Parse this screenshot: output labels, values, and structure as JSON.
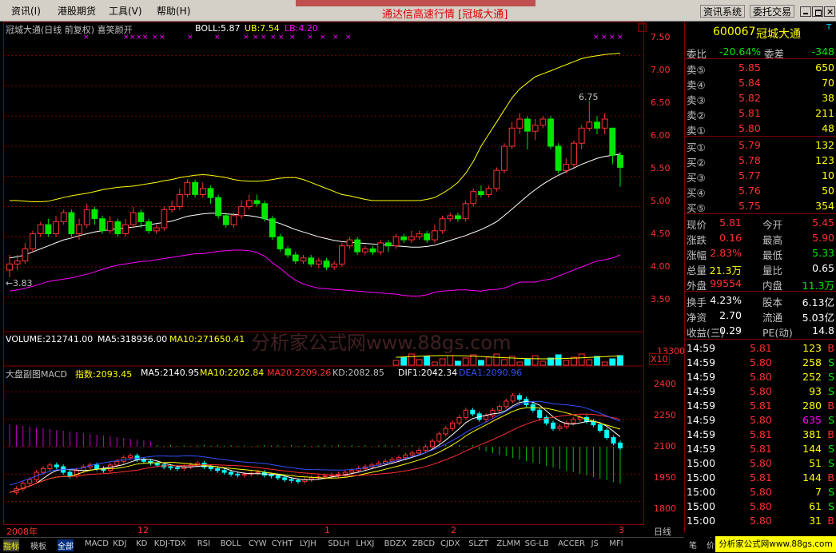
{
  "menu": {
    "items": [
      "资讯(I)",
      "港股期货",
      "工具(V)",
      "帮助(H)"
    ],
    "window_title": "通达信高速行情 [冠城大通]",
    "buttons": [
      "资讯系统",
      "委托交易"
    ]
  },
  "main_chart": {
    "title": "冠城大通(日线 前复权) 喜笑颜开",
    "boll_label": "BOLL:5.87",
    "ub_label": "UB:7.54",
    "lb_label": "LB:4.20",
    "price_ticks": [
      "7.50",
      "7.00",
      "6.50",
      "6.00",
      "5.50",
      "5.00",
      "4.50",
      "4.00",
      "3.50"
    ],
    "high_mark": "6.75",
    "low_mark": "3.83"
  },
  "volume_panel": {
    "label": "VOLUME:212741.00",
    "ma5": "MA5:318936.00",
    "ma10": "MA10:271650.41",
    "tick": "13300",
    "scale": "X10"
  },
  "watermark": "分析家公式网www.88gs.com",
  "index_panel": {
    "title": "大盘副图MACD",
    "index_val": "指数:2093.45",
    "ma5": "MA5:2140.95",
    "ma10": "MA10:2202.84",
    "ma20": "MA20:2209.26",
    "kd": "KD:2082.85",
    "dif1": "DIF1:2042.34",
    "dea1": "DEA1:2090.96",
    "ticks": [
      "2400",
      "2250",
      "2100",
      "1950",
      "1800"
    ]
  },
  "date_axis": {
    "labels": [
      "2008年",
      "12",
      "1",
      "2",
      "3"
    ],
    "period": "日线"
  },
  "quote": {
    "code": "600067",
    "name": "冠城大通",
    "wei_bi_label": "委比",
    "wei_bi": "-20.64%",
    "wei_cha_label": "委差",
    "wei_cha": "-348",
    "sell": [
      {
        "label": "卖⑤",
        "price": "5.85",
        "vol": "650"
      },
      {
        "label": "卖④",
        "price": "5.84",
        "vol": "70"
      },
      {
        "label": "卖③",
        "price": "5.82",
        "vol": "38"
      },
      {
        "label": "卖②",
        "price": "5.81",
        "vol": "211"
      },
      {
        "label": "卖①",
        "price": "5.80",
        "vol": "48"
      }
    ],
    "buy": [
      {
        "label": "买①",
        "price": "5.79",
        "vol": "132"
      },
      {
        "label": "买②",
        "price": "5.78",
        "vol": "123"
      },
      {
        "label": "买③",
        "price": "5.77",
        "vol": "10"
      },
      {
        "label": "买④",
        "price": "5.76",
        "vol": "50"
      },
      {
        "label": "买⑤",
        "price": "5.75",
        "vol": "354"
      }
    ],
    "stats": [
      {
        "l1": "现价",
        "v1": "5.81",
        "l2": "今开",
        "v2": "5.45"
      },
      {
        "l1": "涨跌",
        "v1": "0.16",
        "l2": "最高",
        "v2": "5.90"
      },
      {
        "l1": "涨幅",
        "v1": "2.83%",
        "l2": "最低",
        "v2": "5.33"
      },
      {
        "l1": "总量",
        "v1": "21.3万",
        "l2": "量比",
        "v2": "0.65"
      },
      {
        "l1": "外盘",
        "v1": "99554",
        "l2": "内盘",
        "v2": "11.3万"
      }
    ],
    "stats2": [
      {
        "l1": "换手",
        "v1": "4.23%",
        "l2": "股本",
        "v2": "6.13亿"
      },
      {
        "l1": "净资",
        "v1": "2.70",
        "l2": "流通",
        "v2": "5.03亿"
      },
      {
        "l1": "收益(三)",
        "v1": "0.29",
        "l2": "PE(动)",
        "v2": "14.8"
      }
    ],
    "ticks": [
      {
        "time": "14:59",
        "price": "5.81",
        "vol": "123",
        "bs": "B"
      },
      {
        "time": "14:59",
        "price": "5.80",
        "vol": "258",
        "bs": "S"
      },
      {
        "time": "14:59",
        "price": "5.80",
        "vol": "252",
        "bs": "S"
      },
      {
        "time": "14:59",
        "price": "5.80",
        "vol": "93",
        "bs": "S"
      },
      {
        "time": "14:59",
        "price": "5.81",
        "vol": "280",
        "bs": "B"
      },
      {
        "time": "14:59",
        "price": "5.80",
        "vol": "635",
        "bs": "S"
      },
      {
        "time": "14:59",
        "price": "5.81",
        "vol": "381",
        "bs": "B"
      },
      {
        "time": "14:59",
        "price": "5.81",
        "vol": "144",
        "bs": "S"
      },
      {
        "time": "15:00",
        "price": "5.80",
        "vol": "51",
        "bs": "S"
      },
      {
        "time": "15:00",
        "price": "5.81",
        "vol": "144",
        "bs": "B"
      },
      {
        "time": "15:00",
        "price": "5.80",
        "vol": "7",
        "bs": "S"
      },
      {
        "time": "15:00",
        "price": "5.80",
        "vol": "61",
        "bs": "S"
      },
      {
        "time": "15:00",
        "price": "5.80",
        "vol": "31",
        "bs": "B"
      }
    ]
  },
  "tabs": {
    "items": [
      "指标",
      "模板",
      "全部",
      "MACD",
      "KDJ",
      "KD",
      "KDJ-TDX",
      "RSI",
      "BOLL",
      "CYW",
      "CYHT",
      "LYJH",
      "SDLH",
      "LHXJ",
      "BDZX",
      "ZBCD",
      "CJDX",
      "SLZT",
      "ZLMM",
      "SG-LB",
      "ACCER",
      "JS",
      "MFI"
    ],
    "right": [
      "笔",
      "价"
    ],
    "logo": "分析家公式网www.88gs.com"
  },
  "colors": {
    "up": "#ff3232",
    "down": "#00e600",
    "bg": "#000000",
    "grid": "#800000",
    "boll": "#ffffff",
    "ub": "#ffff00",
    "lb": "#ff00ff"
  },
  "chart_data": {
    "type": "candlestick",
    "price_ylim": [
      3.3,
      7.8
    ],
    "index_ylim": [
      1750,
      2450
    ],
    "candles": [
      [
        3.95,
        4.05,
        4.2,
        3.83
      ],
      [
        4.05,
        4.1,
        4.2,
        3.95
      ],
      [
        4.1,
        4.3,
        4.4,
        4.05
      ],
      [
        4.3,
        4.55,
        4.6,
        4.25
      ],
      [
        4.55,
        4.7,
        4.75,
        4.5
      ],
      [
        4.7,
        4.55,
        4.8,
        4.5
      ],
      [
        4.55,
        4.75,
        4.85,
        4.5
      ],
      [
        4.75,
        4.9,
        4.95,
        4.7
      ],
      [
        4.9,
        4.55,
        4.95,
        4.5
      ],
      [
        4.55,
        4.7,
        4.8,
        4.45
      ],
      [
        4.7,
        4.95,
        5.05,
        4.65
      ],
      [
        4.95,
        4.8,
        5.0,
        4.7
      ],
      [
        4.8,
        4.6,
        4.85,
        4.55
      ],
      [
        4.6,
        4.75,
        4.85,
        4.55
      ],
      [
        4.75,
        4.55,
        4.8,
        4.5
      ],
      [
        4.55,
        4.7,
        4.8,
        4.5
      ],
      [
        4.7,
        4.9,
        5.0,
        4.65
      ],
      [
        4.9,
        4.75,
        4.95,
        4.65
      ],
      [
        4.75,
        4.6,
        4.8,
        4.55
      ],
      [
        4.6,
        4.65,
        4.7,
        4.55
      ],
      [
        4.65,
        4.95,
        5.0,
        4.6
      ],
      [
        4.95,
        5.0,
        5.1,
        4.9
      ],
      [
        5.0,
        5.2,
        5.3,
        4.95
      ],
      [
        5.2,
        5.4,
        5.45,
        5.15
      ],
      [
        5.4,
        5.2,
        5.45,
        5.15
      ],
      [
        5.2,
        5.3,
        5.4,
        5.15
      ],
      [
        5.3,
        5.15,
        5.35,
        5.05
      ],
      [
        5.15,
        4.85,
        5.2,
        4.8
      ],
      [
        4.85,
        4.7,
        4.9,
        4.65
      ],
      [
        4.7,
        4.85,
        4.9,
        4.65
      ],
      [
        4.85,
        5.0,
        5.1,
        4.8
      ],
      [
        5.0,
        5.1,
        5.2,
        4.95
      ],
      [
        5.1,
        5.05,
        5.2,
        5.0
      ],
      [
        5.05,
        4.8,
        5.1,
        4.75
      ],
      [
        4.8,
        4.5,
        4.85,
        4.45
      ],
      [
        4.5,
        4.3,
        4.55,
        4.25
      ],
      [
        4.3,
        4.2,
        4.35,
        4.15
      ],
      [
        4.2,
        4.1,
        4.25,
        4.05
      ],
      [
        4.1,
        4.15,
        4.2,
        4.05
      ],
      [
        4.15,
        4.05,
        4.2,
        4.0
      ],
      [
        4.05,
        4.1,
        4.15,
        3.98
      ],
      [
        4.1,
        4.0,
        4.15,
        3.95
      ],
      [
        4.0,
        4.05,
        4.1,
        3.95
      ],
      [
        4.05,
        4.35,
        4.4,
        4.0
      ],
      [
        4.35,
        4.45,
        4.5,
        4.3
      ],
      [
        4.45,
        4.25,
        4.5,
        4.2
      ],
      [
        4.25,
        4.3,
        4.35,
        4.2
      ],
      [
        4.3,
        4.25,
        4.35,
        4.2
      ],
      [
        4.25,
        4.4,
        4.45,
        4.2
      ],
      [
        4.4,
        4.35,
        4.45,
        4.25
      ],
      [
        4.35,
        4.5,
        4.55,
        4.3
      ],
      [
        4.5,
        4.45,
        4.55,
        4.4
      ],
      [
        4.45,
        4.5,
        4.6,
        4.4
      ],
      [
        4.5,
        4.55,
        4.6,
        4.45
      ],
      [
        4.55,
        4.45,
        4.6,
        4.4
      ],
      [
        4.45,
        4.6,
        4.7,
        4.4
      ],
      [
        4.6,
        4.8,
        4.85,
        4.55
      ],
      [
        4.8,
        4.85,
        4.9,
        4.75
      ],
      [
        4.85,
        4.8,
        4.9,
        4.75
      ],
      [
        4.8,
        5.05,
        5.1,
        4.75
      ],
      [
        5.05,
        5.25,
        5.3,
        5.0
      ],
      [
        5.25,
        5.2,
        5.35,
        5.15
      ],
      [
        5.2,
        5.3,
        5.35,
        5.15
      ],
      [
        5.3,
        5.6,
        5.65,
        5.25
      ],
      [
        5.6,
        6.0,
        6.05,
        5.55
      ],
      [
        6.0,
        6.3,
        6.4,
        5.95
      ],
      [
        6.3,
        6.45,
        6.55,
        6.2
      ],
      [
        6.45,
        6.25,
        6.5,
        5.95
      ],
      [
        6.25,
        6.35,
        6.45,
        6.1
      ],
      [
        6.35,
        6.45,
        6.5,
        6.3
      ],
      [
        6.45,
        6.0,
        6.5,
        5.95
      ],
      [
        6.0,
        5.6,
        6.05,
        5.55
      ],
      [
        5.6,
        5.7,
        5.8,
        5.55
      ],
      [
        5.7,
        6.05,
        6.1,
        5.65
      ],
      [
        6.05,
        6.3,
        6.35,
        5.95
      ],
      [
        6.3,
        6.4,
        6.75,
        6.25
      ],
      [
        6.4,
        6.3,
        6.5,
        6.2
      ],
      [
        6.3,
        6.45,
        6.55,
        6.2
      ],
      [
        6.3,
        5.85,
        6.3,
        5.7
      ],
      [
        5.85,
        5.65,
        5.9,
        5.33
      ]
    ],
    "boll": [
      4.15,
      4.17,
      4.2,
      4.25,
      4.3,
      4.35,
      4.4,
      4.45,
      4.48,
      4.52,
      4.55,
      4.58,
      4.6,
      4.62,
      4.63,
      4.65,
      4.66,
      4.68,
      4.7,
      4.72,
      4.74,
      4.76,
      4.8,
      4.84,
      4.86,
      4.88,
      4.89,
      4.89,
      4.88,
      4.87,
      4.86,
      4.85,
      4.83,
      4.8,
      4.76,
      4.72,
      4.67,
      4.62,
      4.58,
      4.54,
      4.5,
      4.47,
      4.44,
      4.42,
      4.41,
      4.4,
      4.39,
      4.38,
      4.37,
      4.36,
      4.35,
      4.34,
      4.33,
      4.33,
      4.34,
      4.36,
      4.4,
      4.44,
      4.48,
      4.52,
      4.57,
      4.62,
      4.68,
      4.75,
      4.85,
      4.96,
      5.07,
      5.18,
      5.28,
      5.37,
      5.45,
      5.52,
      5.58,
      5.64,
      5.7,
      5.75,
      5.8,
      5.83,
      5.85,
      5.87
    ],
    "ub": [
      5.1,
      5.1,
      5.09,
      5.08,
      5.08,
      5.09,
      5.12,
      5.15,
      5.18,
      5.2,
      5.22,
      5.25,
      5.28,
      5.3,
      5.32,
      5.33,
      5.34,
      5.36,
      5.38,
      5.4,
      5.43,
      5.45,
      5.48,
      5.5,
      5.52,
      5.53,
      5.52,
      5.5,
      5.48,
      5.45,
      5.43,
      5.42,
      5.42,
      5.43,
      5.45,
      5.47,
      5.48,
      5.48,
      5.45,
      5.4,
      5.35,
      5.3,
      5.25,
      5.2,
      5.18,
      5.15,
      5.12,
      5.1,
      5.1,
      5.1,
      5.1,
      5.1,
      5.1,
      5.1,
      5.12,
      5.15,
      5.22,
      5.3,
      5.4,
      5.55,
      5.75,
      6.0,
      6.2,
      6.4,
      6.6,
      6.8,
      6.95,
      7.05,
      7.15,
      7.2,
      7.25,
      7.3,
      7.35,
      7.4,
      7.45,
      7.48,
      7.5,
      7.52,
      7.53,
      7.54
    ],
    "lb": [
      3.6,
      3.62,
      3.65,
      3.68,
      3.72,
      3.76,
      3.78,
      3.8,
      3.82,
      3.85,
      3.88,
      3.92,
      3.96,
      4.0,
      4.03,
      4.05,
      4.07,
      4.09,
      4.1,
      4.12,
      4.14,
      4.16,
      4.18,
      4.2,
      4.22,
      4.22,
      4.24,
      4.26,
      4.27,
      4.28,
      4.28,
      4.27,
      4.24,
      4.18,
      4.07,
      3.98,
      3.87,
      3.78,
      3.72,
      3.68,
      3.65,
      3.64,
      3.63,
      3.62,
      3.61,
      3.6,
      3.59,
      3.58,
      3.57,
      3.56,
      3.55,
      3.53,
      3.52,
      3.52,
      3.54,
      3.58,
      3.6,
      3.61,
      3.62,
      3.62,
      3.61,
      3.6,
      3.62,
      3.63,
      3.65,
      3.7,
      3.75,
      3.75,
      3.75,
      3.78,
      3.8,
      3.85,
      3.9,
      3.95,
      4.0,
      4.05,
      4.1,
      4.12,
      4.15,
      4.2
    ],
    "index": [
      1850,
      1870,
      1900,
      1920,
      1960,
      1980,
      2000,
      1990,
      1960,
      1940,
      1970,
      1990,
      2000,
      1980,
      1970,
      2000,
      2020,
      2040,
      2050,
      2030,
      2020,
      2010,
      2000,
      1990,
      1985,
      1980,
      1990,
      2000,
      2010,
      1990,
      1980,
      1970,
      1960,
      1950,
      1945,
      1950,
      1955,
      1960,
      1945,
      1940,
      1930,
      1920,
      1915,
      1910,
      1920,
      1930,
      1935,
      1940,
      1945,
      1950,
      1960,
      1970,
      1980,
      1990,
      2000,
      2010,
      2020,
      2030,
      2040,
      2055,
      2065,
      2080,
      2100,
      2130,
      2170,
      2200,
      2230,
      2260,
      2300,
      2280,
      2250,
      2270,
      2300,
      2320,
      2350,
      2380,
      2360,
      2330,
      2300,
      2260,
      2230,
      2200,
      2210,
      2230,
      2250,
      2260,
      2240,
      2220,
      2190,
      2150,
      2120,
      2093
    ]
  }
}
